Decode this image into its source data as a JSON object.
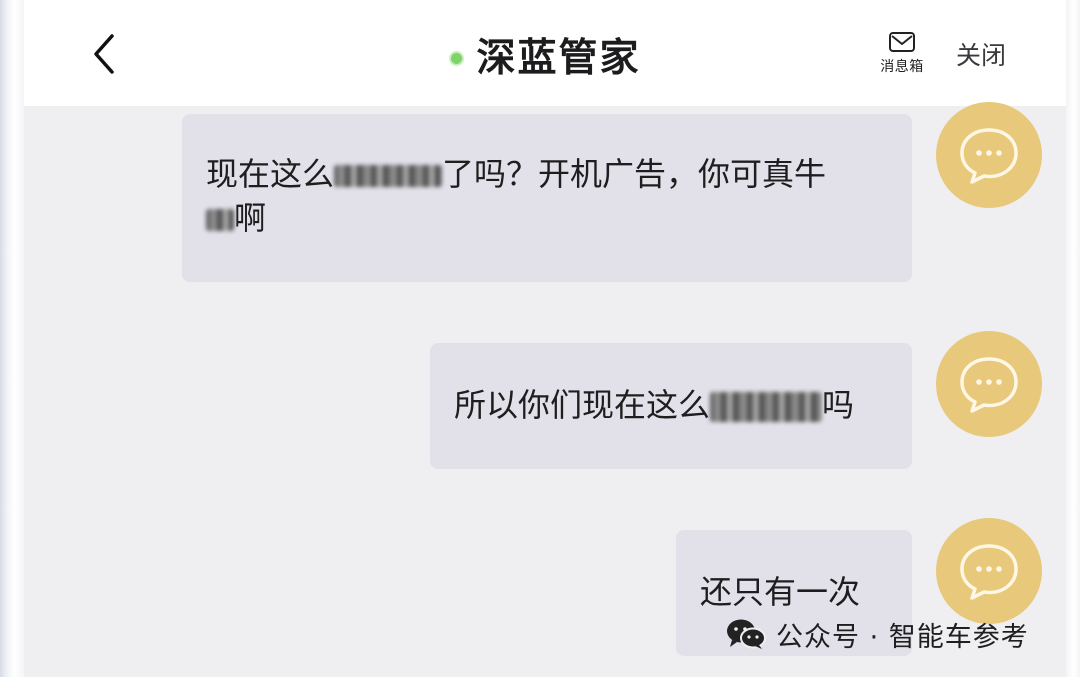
{
  "header": {
    "back_icon": "chevron-left-icon",
    "title": "深蓝管家",
    "status_color": "#7ed36a",
    "inbox_icon": "envelope-icon",
    "inbox_label": "消息箱",
    "close_label": "关闭"
  },
  "messages": [
    {
      "line1_a": "现在这么",
      "line1_b": "了吗？开机广告，你可真牛",
      "line2_b": "啊",
      "avatar_icon": "chat-bubble-icon"
    },
    {
      "text_a": "所以你们现在这么",
      "text_b": "吗",
      "avatar_icon": "chat-bubble-icon"
    },
    {
      "text_a": "还只有一次",
      "avatar_icon": "chat-bubble-icon"
    }
  ],
  "colors": {
    "bubble": "#e2e1ea",
    "avatar": "#e8c87a",
    "background": "#efeff1"
  },
  "watermark": {
    "icon": "wechat-icon",
    "text": "公众号 · 智能车参考"
  }
}
